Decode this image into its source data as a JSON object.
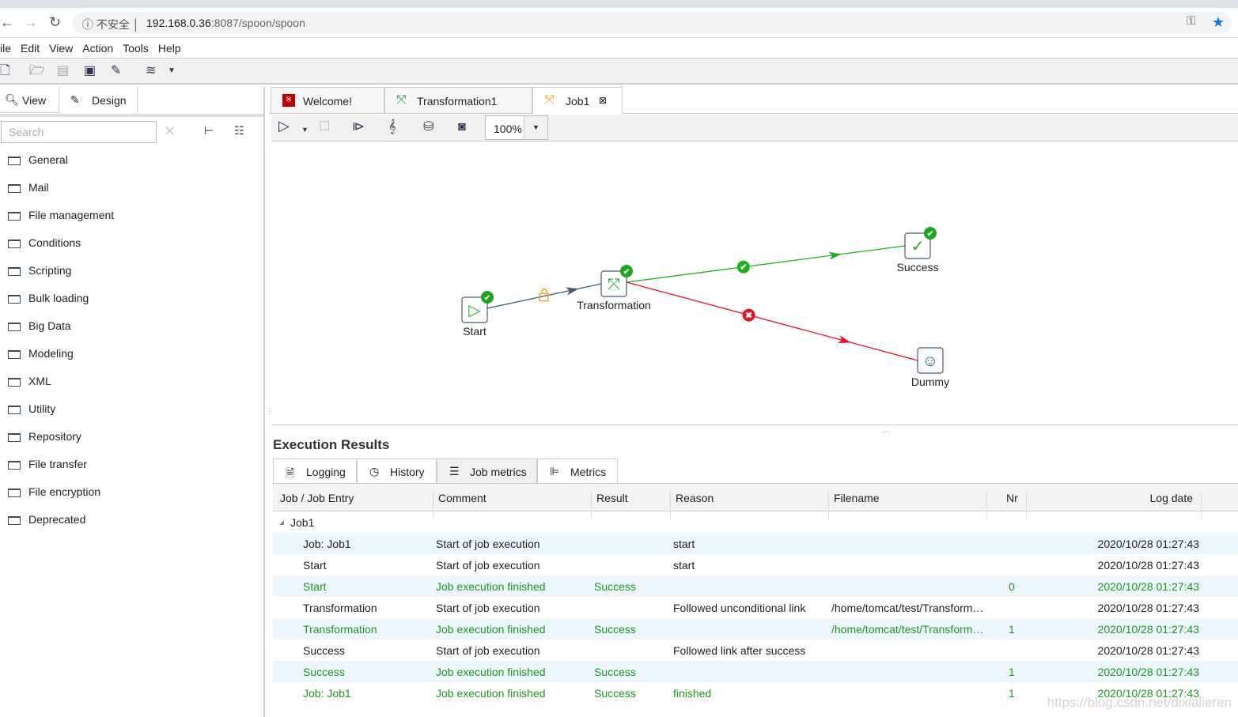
{
  "browser": {
    "insecure_label": "不安全",
    "url_host": "192.168.0.36",
    "url_rest": ":8087/spoon/spoon"
  },
  "menu": [
    "ile",
    "Edit",
    "View",
    "Action",
    "Tools",
    "Help"
  ],
  "left_panel": {
    "tabs": [
      {
        "label": "View",
        "icon": "view-icon"
      },
      {
        "label": "Design",
        "icon": "pencil-icon"
      }
    ],
    "search_placeholder": "Search",
    "folders": [
      "General",
      "Mail",
      "File management",
      "Conditions",
      "Scripting",
      "Bulk loading",
      "Big Data",
      "Modeling",
      "XML",
      "Utility",
      "Repository",
      "File transfer",
      "File encryption",
      "Deprecated"
    ]
  },
  "editor_tabs": [
    {
      "label": "Welcome!",
      "icon": "welcome-icon",
      "color": "#c00000"
    },
    {
      "label": "Transformation1",
      "icon": "transformation-icon",
      "color": "#2aa836"
    },
    {
      "label": "Job1",
      "icon": "job-icon",
      "color": "#f5a623",
      "active": true
    }
  ],
  "job_toolbar": {
    "zoom": "100%"
  },
  "canvas": {
    "nodes": [
      {
        "id": "start",
        "label": "Start"
      },
      {
        "id": "transformation",
        "label": "Transformation"
      },
      {
        "id": "success",
        "label": "Success"
      },
      {
        "id": "dummy",
        "label": "Dummy"
      }
    ],
    "hops": [
      {
        "from": "start",
        "to": "transformation",
        "type": "unconditional",
        "color": "#3f5a75"
      },
      {
        "from": "transformation",
        "to": "success",
        "type": "success",
        "color": "#1db01d"
      },
      {
        "from": "transformation",
        "to": "dummy",
        "type": "failure",
        "color": "#e8101e"
      }
    ]
  },
  "results": {
    "title": "Execution Results",
    "tabs": [
      {
        "label": "Logging",
        "icon": "logging-icon"
      },
      {
        "label": "History",
        "icon": "history-icon"
      },
      {
        "label": "Job metrics",
        "icon": "job-metrics-icon",
        "active": true
      },
      {
        "label": "Metrics",
        "icon": "metrics-icon"
      }
    ],
    "columns": [
      "Job / Job Entry",
      "Comment",
      "Result",
      "Reason",
      "Filename",
      "Nr",
      "Log date"
    ],
    "tree_root": "Job1",
    "rows": [
      {
        "entry": "Job: Job1",
        "comment": "Start of job execution",
        "result": "",
        "reason": "start",
        "filename": "",
        "nr": "",
        "date": "2020/10/28 01:27:43",
        "green": false
      },
      {
        "entry": "Start",
        "comment": "Start of job execution",
        "result": "",
        "reason": "start",
        "filename": "",
        "nr": "",
        "date": "2020/10/28 01:27:43",
        "green": false
      },
      {
        "entry": "Start",
        "comment": "Job execution finished",
        "result": "Success",
        "reason": "",
        "filename": "",
        "nr": "0",
        "date": "2020/10/28 01:27:43",
        "green": true
      },
      {
        "entry": "Transformation",
        "comment": "Start of job execution",
        "result": "",
        "reason": "Followed unconditional link",
        "filename": "/home/tomcat/test/Transform…",
        "nr": "",
        "date": "2020/10/28 01:27:43",
        "green": false
      },
      {
        "entry": "Transformation",
        "comment": "Job execution finished",
        "result": "Success",
        "reason": "",
        "filename": "/home/tomcat/test/Transform…",
        "nr": "1",
        "date": "2020/10/28 01:27:43",
        "green": true
      },
      {
        "entry": "Success",
        "comment": "Start of job execution",
        "result": "",
        "reason": "Followed link after success",
        "filename": "",
        "nr": "",
        "date": "2020/10/28 01:27:43",
        "green": false
      },
      {
        "entry": "Success",
        "comment": "Job execution finished",
        "result": "Success",
        "reason": "",
        "filename": "",
        "nr": "1",
        "date": "2020/10/28 01:27:43",
        "green": true
      },
      {
        "entry": "Job: Job1",
        "comment": "Job execution finished",
        "result": "Success",
        "reason": "finished",
        "filename": "",
        "nr": "1",
        "date": "2020/10/28 01:27:43",
        "green": true
      }
    ]
  },
  "watermark": "https://blog.csdn.net/dixialieren"
}
